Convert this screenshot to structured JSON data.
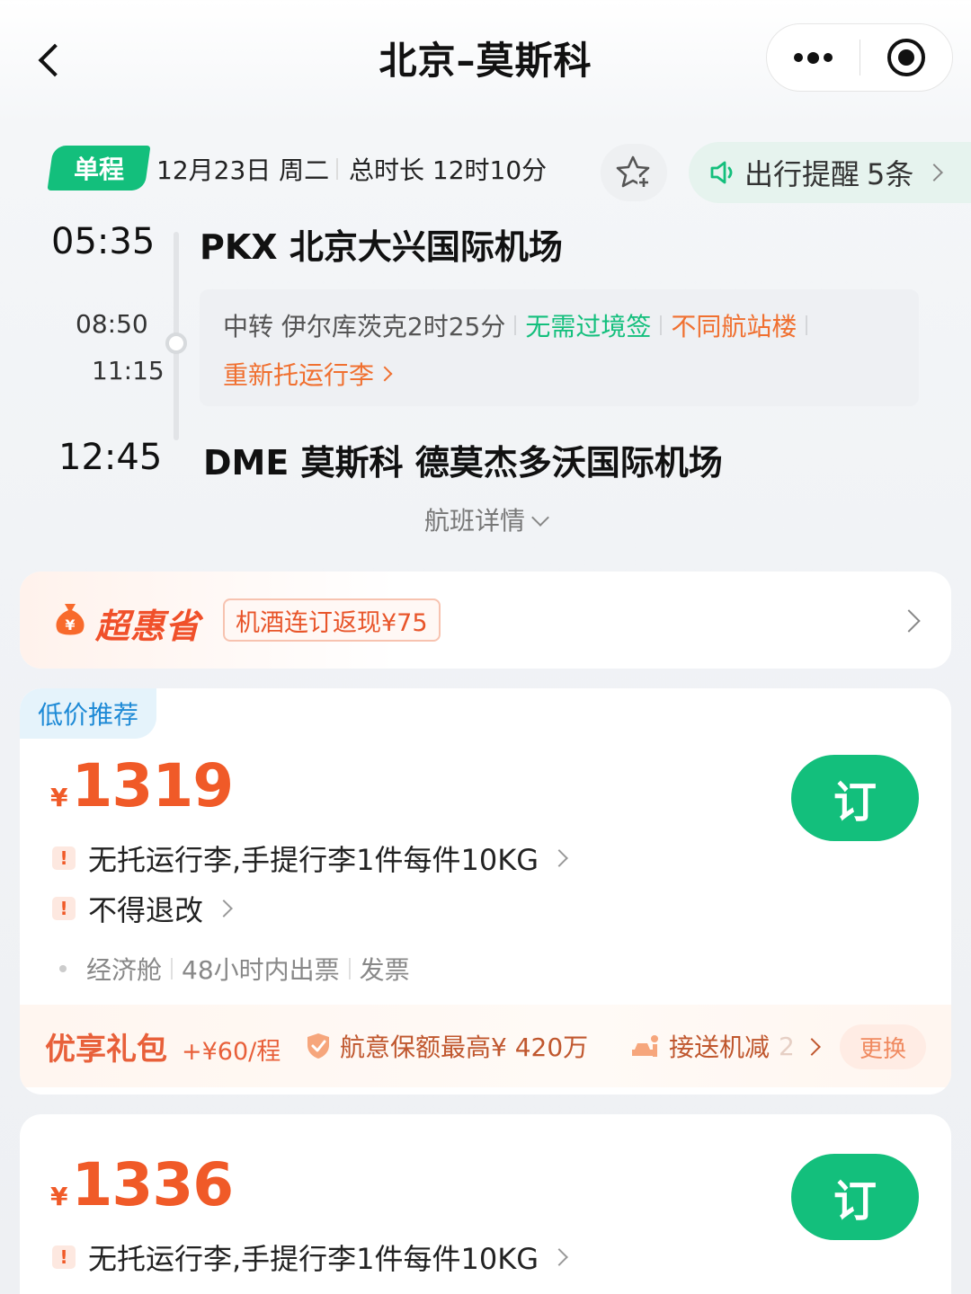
{
  "nav": {
    "title": "北京–莫斯科"
  },
  "trip": {
    "type_tag": "单程",
    "date": "12月23日 周二",
    "duration": "总时长 12时10分",
    "reminder": "出行提醒",
    "reminder_count": "5条"
  },
  "route": {
    "depart_time": "05:35",
    "depart_airport": "PKX 北京大兴国际机场",
    "transfer_arrive": "08:50",
    "transfer_depart": "11:15",
    "transfer_info": "中转 伊尔库茨克2时25分",
    "no_visa": "无需过境签",
    "diff_terminal": "不同航站楼",
    "recheck": "重新托运行李",
    "arrive_time": "12:45",
    "arrive_airport": "DME 莫斯科 德莫杰多沃国际机场",
    "detail_link": "航班详情"
  },
  "promo": {
    "brand": "超惠省",
    "tag": "机酒连订返现¥75"
  },
  "fares": [
    {
      "tag": "低价推荐",
      "currency": "¥",
      "price": "1319",
      "book": "订",
      "rules": [
        "无托运行李,手提行李1件每件10KG",
        "不得退改"
      ],
      "meta": [
        "经济舱",
        "48小时内出票",
        "发票"
      ],
      "gift_title": "优享礼包",
      "gift_price": "+¥60/程",
      "gift_insurance": "航意保额最高¥ 420万",
      "gift_transfer": "接送机减",
      "gift_transfer_amt": "2",
      "swap": "更换"
    },
    {
      "currency": "¥",
      "price": "1336",
      "book": "订",
      "rules": [
        "无托运行李,手提行李1件每件10KG"
      ]
    }
  ],
  "colors": {
    "brand_green": "#13bf7c",
    "price_orange": "#f05a28",
    "link_blue": "#1e8ad6"
  }
}
